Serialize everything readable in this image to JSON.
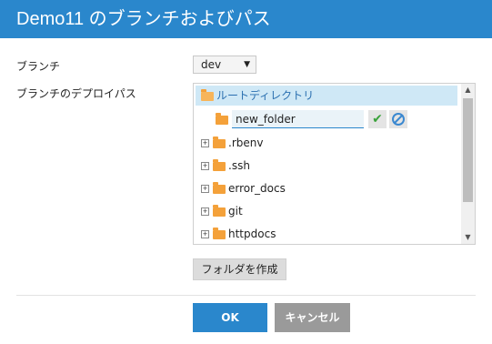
{
  "title": "Demo11 のブランチおよびパス",
  "colors": {
    "header": "#2a87cc",
    "selected_row": "#cfe8f6",
    "folder": "#f4a13a",
    "cancel": "#9a9a9a"
  },
  "branch": {
    "label": "ブランチ",
    "value": "dev"
  },
  "deploy_path": {
    "label": "ブランチのデプロイパス"
  },
  "tree": {
    "root": "ルートディレクトリ",
    "new_folder_value": "new_folder",
    "items": [
      ".rbenv",
      ".ssh",
      "error_docs",
      "git",
      "httpdocs"
    ]
  },
  "buttons": {
    "create_folder": "フォルダを作成",
    "ok": "OK",
    "cancel": "キャンセル"
  },
  "icons": {
    "confirm": "checkmark-icon",
    "discard": "cancel-circle-icon",
    "folder": "folder-icon",
    "expand": "plus-box-icon"
  }
}
